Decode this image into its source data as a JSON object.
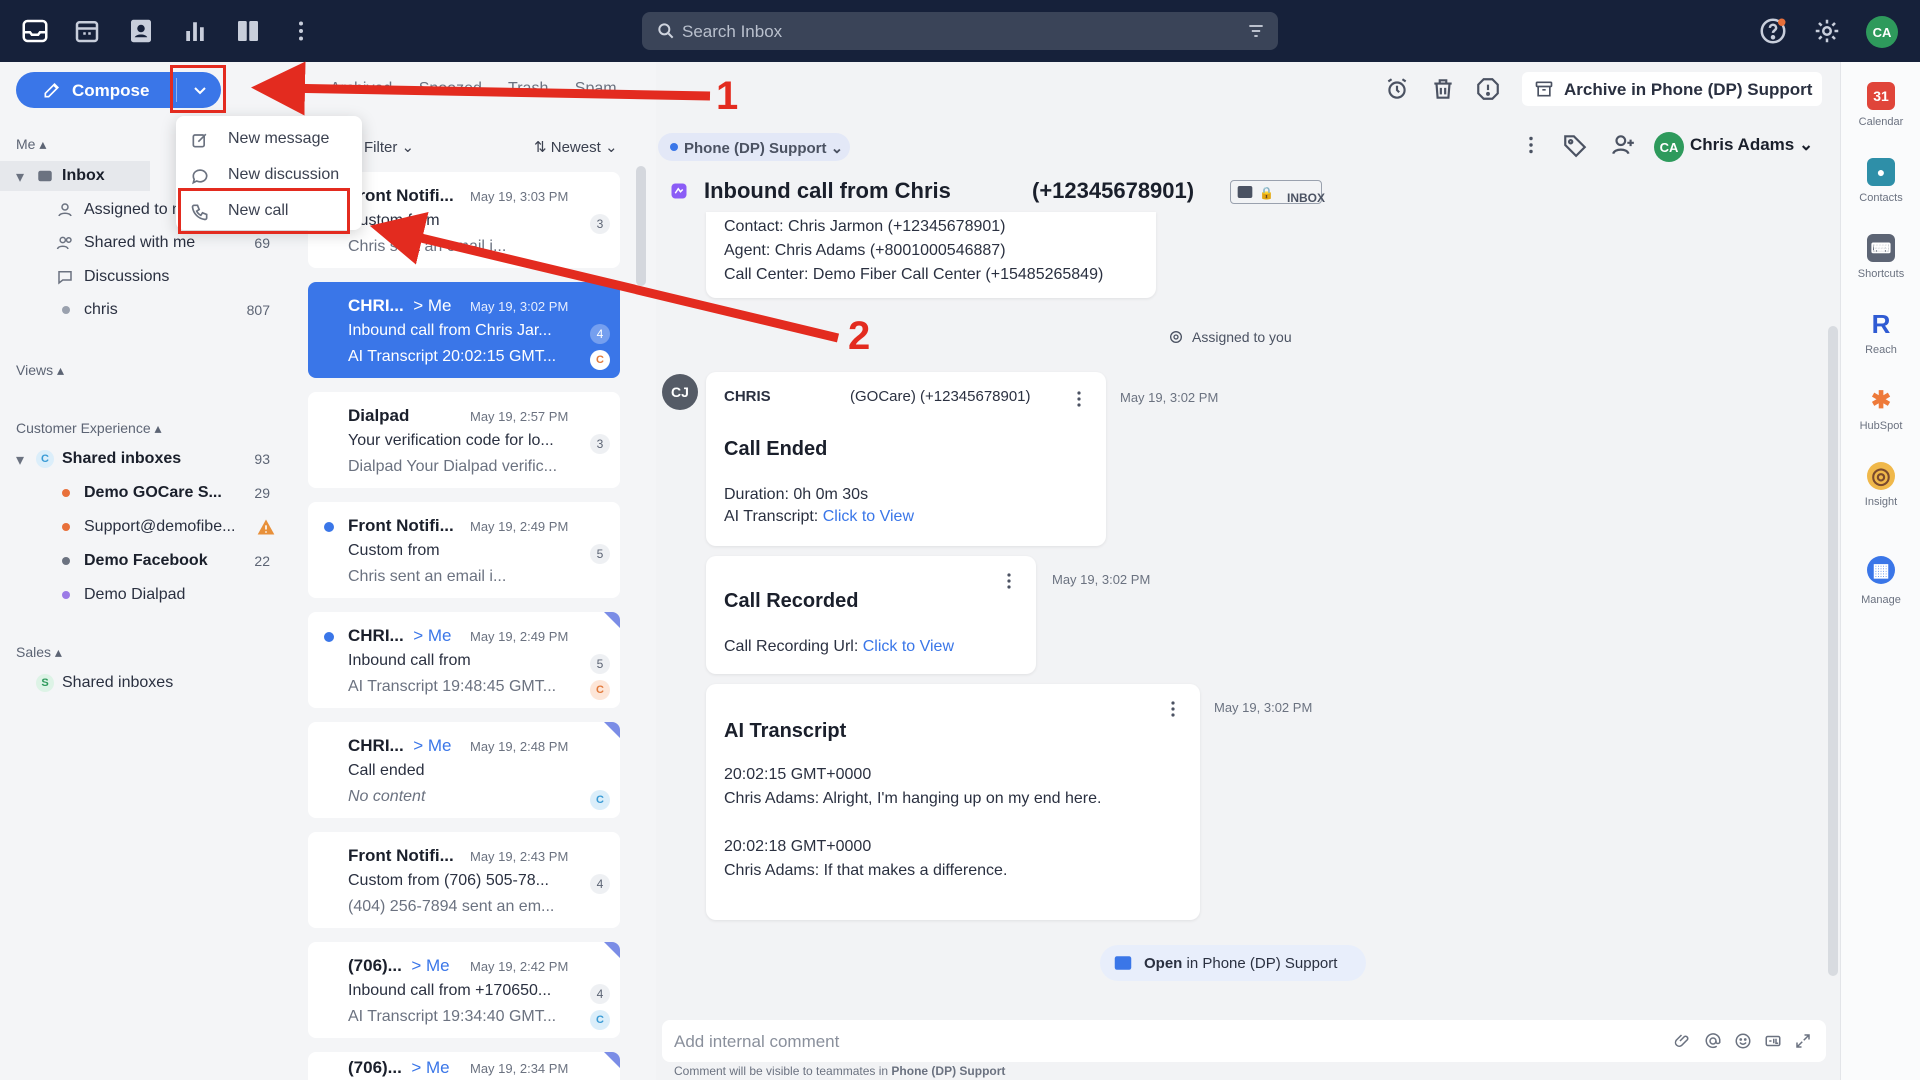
{
  "search": {
    "placeholder": "Search Inbox"
  },
  "user": {
    "initials": "CA",
    "name": "Chris Adams"
  },
  "compose": {
    "label": "Compose"
  },
  "compose_menu": [
    {
      "label": "New message",
      "icon": "edit-icon"
    },
    {
      "label": "New discussion",
      "icon": "chat-bubble-icon"
    },
    {
      "label": "New call",
      "icon": "phone-icon"
    }
  ],
  "folders": [
    "Archived",
    "Snoozed",
    "Trash",
    "Spam"
  ],
  "sidebar": {
    "me_header": "Me",
    "inbox": "Inbox",
    "assigned": "Assigned to me",
    "shared": {
      "label": "Shared with me",
      "count": "69"
    },
    "discussions": "Discussions",
    "chris": {
      "label": "chris",
      "count": "807"
    },
    "views_header": "Views",
    "cx_header": "Customer Experience",
    "cx_shared": {
      "badge": "C",
      "label": "Shared inboxes",
      "count": "93"
    },
    "cx_items": [
      {
        "label": "Demo GOCare S...",
        "count": "29",
        "color": "#e8703a",
        "bold": true
      },
      {
        "label": "Support@demofibe...",
        "count": "",
        "color": "#e8703a",
        "bold": false
      },
      {
        "label": "Demo Facebook",
        "count": "22",
        "color": "#6b7280",
        "bold": true
      },
      {
        "label": "Demo Dialpad",
        "count": "",
        "color": "#9b7be6",
        "bold": false
      }
    ],
    "sales_header": "Sales",
    "sales_shared": {
      "badge": "S",
      "label": "Shared inboxes"
    }
  },
  "list": {
    "filter": "Filter",
    "sort": "Newest",
    "cards": [
      {
        "from": "Front Notifi...",
        "me": "",
        "time": "May 19, 3:03 PM",
        "subject": "Custom from",
        "preview": "Chris      sent an email i...",
        "count": "3",
        "badge": "",
        "unread": false
      },
      {
        "from": "CHRI...",
        "me": "> Me",
        "time": "May 19, 3:02 PM",
        "subject": "Inbound call from Chris Jar...",
        "preview": "AI Transcript 20:02:15 GMT...",
        "count": "4",
        "badge": "C",
        "unread": false
      },
      {
        "from": "Dialpad",
        "me": "",
        "time": "May 19, 2:57 PM",
        "subject": "Your verification code for lo...",
        "preview": "Dialpad Your Dialpad verific...",
        "count": "3",
        "badge": "",
        "unread": false
      },
      {
        "from": "Front Notifi...",
        "me": "",
        "time": "May 19, 2:49 PM",
        "subject": "Custom from",
        "preview": "Chris        sent an email i...",
        "count": "5",
        "badge": "",
        "unread": true
      },
      {
        "from": "CHRI...",
        "me": "> Me",
        "time": "May 19, 2:49 PM",
        "subject": "Inbound call from",
        "preview": "AI Transcript 19:48:45 GMT...",
        "count": "5",
        "badge": "C",
        "unread": true
      },
      {
        "from": "CHRI...",
        "me": "> Me",
        "time": "May 19, 2:48 PM",
        "subject": "Call ended",
        "preview": "No content",
        "count": "",
        "badge": "C",
        "unread": false
      },
      {
        "from": "Front Notifi...",
        "me": "",
        "time": "May 19, 2:43 PM",
        "subject": "Custom from (706) 505-78...",
        "preview": "(404) 256-7894   sent an em...",
        "count": "4",
        "badge": "",
        "unread": false
      },
      {
        "from": "(706)...",
        "me": "> Me",
        "time": "May 19, 2:42 PM",
        "subject": "Inbound call from +170650...",
        "preview": "AI Transcript 19:34:40 GMT...",
        "count": "4",
        "badge": "C",
        "unread": false
      },
      {
        "from": "(706)...",
        "me": "> Me",
        "time": "May 19, 2:34 PM",
        "subject": "",
        "preview": "",
        "count": "",
        "badge": "",
        "unread": false
      }
    ]
  },
  "toolbar": {
    "archive": "Archive in Phone (DP) Support"
  },
  "conversation": {
    "inbox_chip": "Phone (DP) Support",
    "title": "Inbound call from Chris",
    "phone": "(+12345678901)",
    "inbox_badge": "INBOX",
    "details": {
      "contact": "Contact: Chris Jarmon (+12345678901)",
      "agent": "Agent: Chris Adams (+8001000546887)",
      "center": "Call Center: Demo Fiber Call Center (+15485265849)"
    },
    "assigned": "Assigned to you",
    "sender_initials": "CJ",
    "msg1": {
      "name": "CHRIS",
      "org": "(GOCare) (+12345678901)",
      "time": "May 19, 3:02 PM",
      "heading": "Call Ended",
      "duration": "Duration: 0h 0m 30s",
      "transcript_label": "AI Transcript:",
      "link": "Click to View"
    },
    "msg2": {
      "time": "May 19, 3:02 PM",
      "heading": "Call Recorded",
      "label": "Call Recording Url:",
      "link": "Click to View"
    },
    "msg3": {
      "time": "May 19, 3:02 PM",
      "heading": "AI Transcript",
      "t1": "20:02:15 GMT+0000",
      "l1": "Chris Adams: Alright, I'm hanging up on my end here.",
      "t2": "20:02:18 GMT+0000",
      "l2": "Chris Adams: If that makes a difference."
    },
    "open_in_prefix": "Open",
    "open_in_suffix": " in Phone (DP) Support",
    "comment_placeholder": "Add internal comment",
    "hint_prefix": "Comment will be visible to teammates in ",
    "hint_inbox": "Phone (DP) Support"
  },
  "rail": [
    {
      "label": "Calendar",
      "icon": "calendar-icon",
      "glyph": "31",
      "color": "#e0453a"
    },
    {
      "label": "Contacts",
      "icon": "contacts-icon",
      "glyph": "●",
      "color": "#2e8fa8"
    },
    {
      "label": "Shortcuts",
      "icon": "keyboard-icon",
      "glyph": "⌨",
      "color": "#5c6474"
    },
    {
      "label": "Reach",
      "icon": "reach-icon",
      "glyph": "R",
      "color": "#2f5bd3"
    },
    {
      "label": "HubSpot",
      "icon": "hubspot-icon",
      "glyph": "✱",
      "color": "#ee7a3a"
    },
    {
      "label": "Insight",
      "icon": "insight-icon",
      "glyph": "◎",
      "color": "#7b4a2e"
    },
    {
      "label": "Manage",
      "icon": "grid-icon",
      "glyph": "▦",
      "color": "#3a76e8"
    }
  ],
  "annotations": [
    "1",
    "2"
  ]
}
